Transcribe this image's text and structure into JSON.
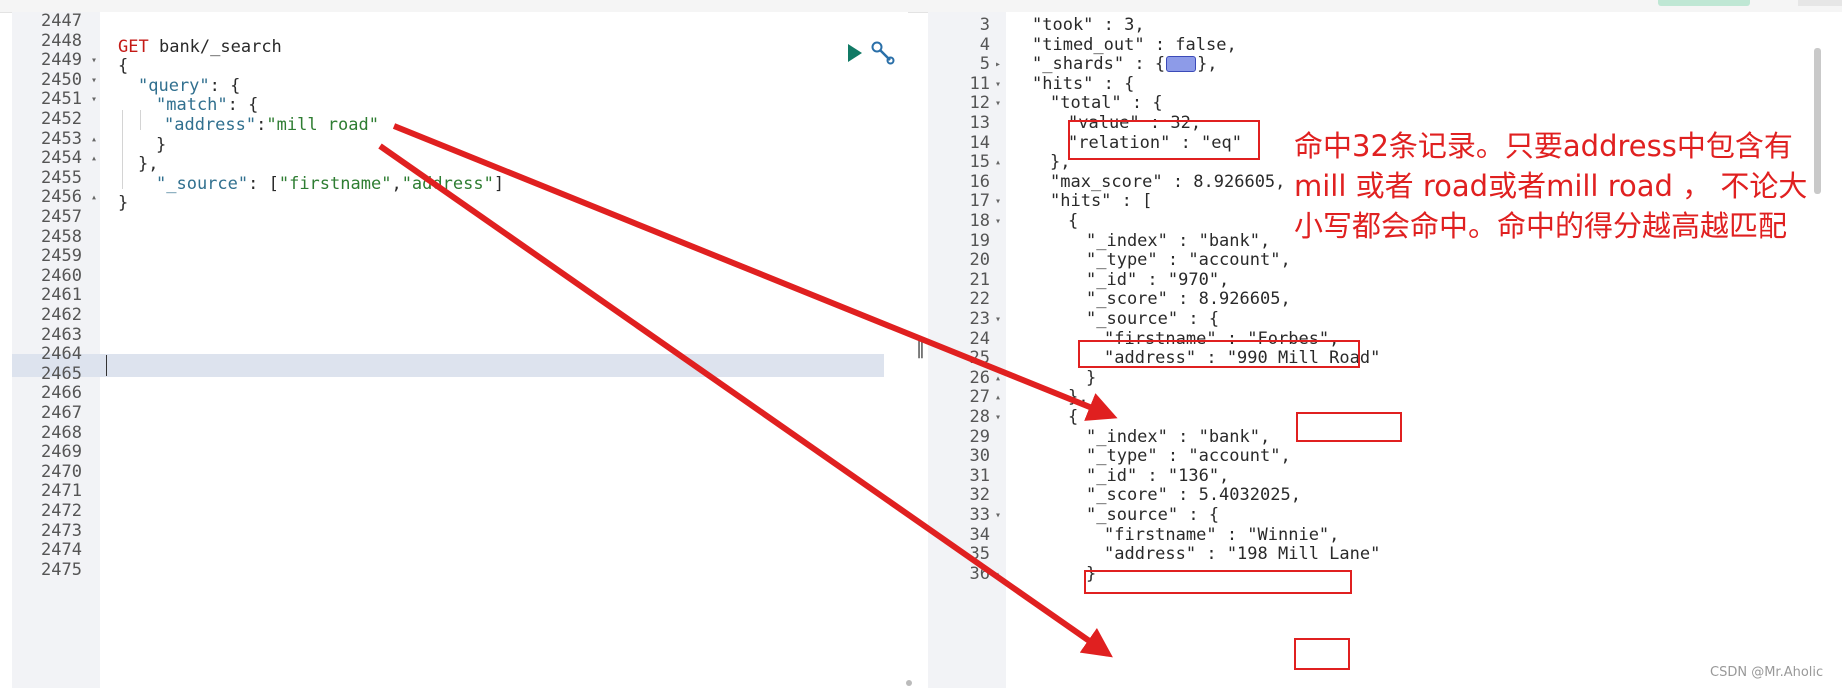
{
  "request": {
    "method": "GET",
    "path": "bank/_search",
    "lines": [
      {
        "num": "2447",
        "fold": ""
      },
      {
        "num": "2448",
        "fold": ""
      },
      {
        "num": "2449",
        "fold": "▾"
      },
      {
        "num": "2450",
        "fold": "▾"
      },
      {
        "num": "2451",
        "fold": "▾"
      },
      {
        "num": "2452",
        "fold": ""
      },
      {
        "num": "2453",
        "fold": "▴"
      },
      {
        "num": "2454",
        "fold": "▴"
      },
      {
        "num": "2455",
        "fold": ""
      },
      {
        "num": "2456",
        "fold": "▴"
      },
      {
        "num": "2457",
        "fold": ""
      },
      {
        "num": "2458",
        "fold": ""
      },
      {
        "num": "2459",
        "fold": ""
      },
      {
        "num": "2460",
        "fold": ""
      },
      {
        "num": "2461",
        "fold": ""
      },
      {
        "num": "2462",
        "fold": ""
      },
      {
        "num": "2463",
        "fold": ""
      },
      {
        "num": "2464",
        "fold": ""
      },
      {
        "num": "2465",
        "fold": ""
      },
      {
        "num": "2466",
        "fold": ""
      },
      {
        "num": "2467",
        "fold": ""
      },
      {
        "num": "2468",
        "fold": ""
      },
      {
        "num": "2469",
        "fold": ""
      },
      {
        "num": "2470",
        "fold": ""
      },
      {
        "num": "2471",
        "fold": ""
      },
      {
        "num": "2472",
        "fold": ""
      },
      {
        "num": "2473",
        "fold": ""
      },
      {
        "num": "2474",
        "fold": ""
      },
      {
        "num": "2475",
        "fold": ""
      }
    ],
    "code": {
      "open_brace": "{",
      "query_key": "\"query\"",
      "query_open": ": {",
      "match_key": "\"match\"",
      "match_open": ": {",
      "address_key": "\"address\"",
      "colon": ":",
      "address_value": "\"mill road\"",
      "close_inner": "}",
      "close_query": "},",
      "source_key": "\"_source\"",
      "source_prefix": ": [",
      "source_f1": "\"firstname\"",
      "source_comma": ",",
      "source_f2": "\"address\"",
      "source_suffix": "]",
      "close_brace": "}"
    }
  },
  "response": {
    "lines": [
      {
        "num": "3",
        "fold": "",
        "text": "\"took\" : 3,"
      },
      {
        "num": "4",
        "fold": "",
        "text": "\"timed_out\" : false,"
      },
      {
        "num": "5",
        "fold": "▸",
        "text": "\"_shards\" : {"
      },
      {
        "num": "11",
        "fold": "▾",
        "text": "\"hits\" : {"
      },
      {
        "num": "12",
        "fold": "▾",
        "text": "\"total\" : {"
      },
      {
        "num": "13",
        "fold": "",
        "text": "\"value\" : 32,"
      },
      {
        "num": "14",
        "fold": "",
        "text": "\"relation\" : \"eq\""
      },
      {
        "num": "15",
        "fold": "▴",
        "text": "},"
      },
      {
        "num": "16",
        "fold": "",
        "text": "\"max_score\" : 8.926605,"
      },
      {
        "num": "17",
        "fold": "▾",
        "text": "\"hits\" : ["
      },
      {
        "num": "18",
        "fold": "▾",
        "text": "{"
      },
      {
        "num": "19",
        "fold": "",
        "text": "\"_index\" : \"bank\","
      },
      {
        "num": "20",
        "fold": "",
        "text": "\"_type\" : \"account\","
      },
      {
        "num": "21",
        "fold": "",
        "text": "\"_id\" : \"970\","
      },
      {
        "num": "22",
        "fold": "",
        "text": "\"_score\" : 8.926605,"
      },
      {
        "num": "23",
        "fold": "▾",
        "text": "\"_source\" : {"
      },
      {
        "num": "24",
        "fold": "",
        "text": "\"firstname\" : \"Forbes\","
      },
      {
        "num": "25",
        "fold": "",
        "text": "\"address\" : \"990 Mill Road\""
      },
      {
        "num": "26",
        "fold": "▴",
        "text": "}"
      },
      {
        "num": "27",
        "fold": "▴",
        "text": "},"
      },
      {
        "num": "28",
        "fold": "▾",
        "text": "{"
      },
      {
        "num": "29",
        "fold": "",
        "text": "\"_index\" : \"bank\","
      },
      {
        "num": "30",
        "fold": "",
        "text": "\"_type\" : \"account\","
      },
      {
        "num": "31",
        "fold": "",
        "text": "\"_id\" : \"136\","
      },
      {
        "num": "32",
        "fold": "",
        "text": "\"_score\" : 5.4032025,"
      },
      {
        "num": "33",
        "fold": "▾",
        "text": "\"_source\" : {"
      },
      {
        "num": "34",
        "fold": "",
        "text": "\"firstname\" : \"Winnie\","
      },
      {
        "num": "35",
        "fold": "",
        "text": "\"address\" : \"198 Mill Lane\""
      },
      {
        "num": "36",
        "fold": "▴",
        "text": "}"
      }
    ],
    "shards_close": "},"
  },
  "annotation": {
    "text": "命中32条记录。只要address中包含有mill 或者 road或者mill road ， 不论大小写都会命中。命中的得分越高越匹配",
    "color": "#e02020"
  },
  "watermark": "CSDN @Mr.Aholic",
  "icons": [
    "play-icon",
    "wrench-icon",
    "collapsed-object-icon"
  ]
}
